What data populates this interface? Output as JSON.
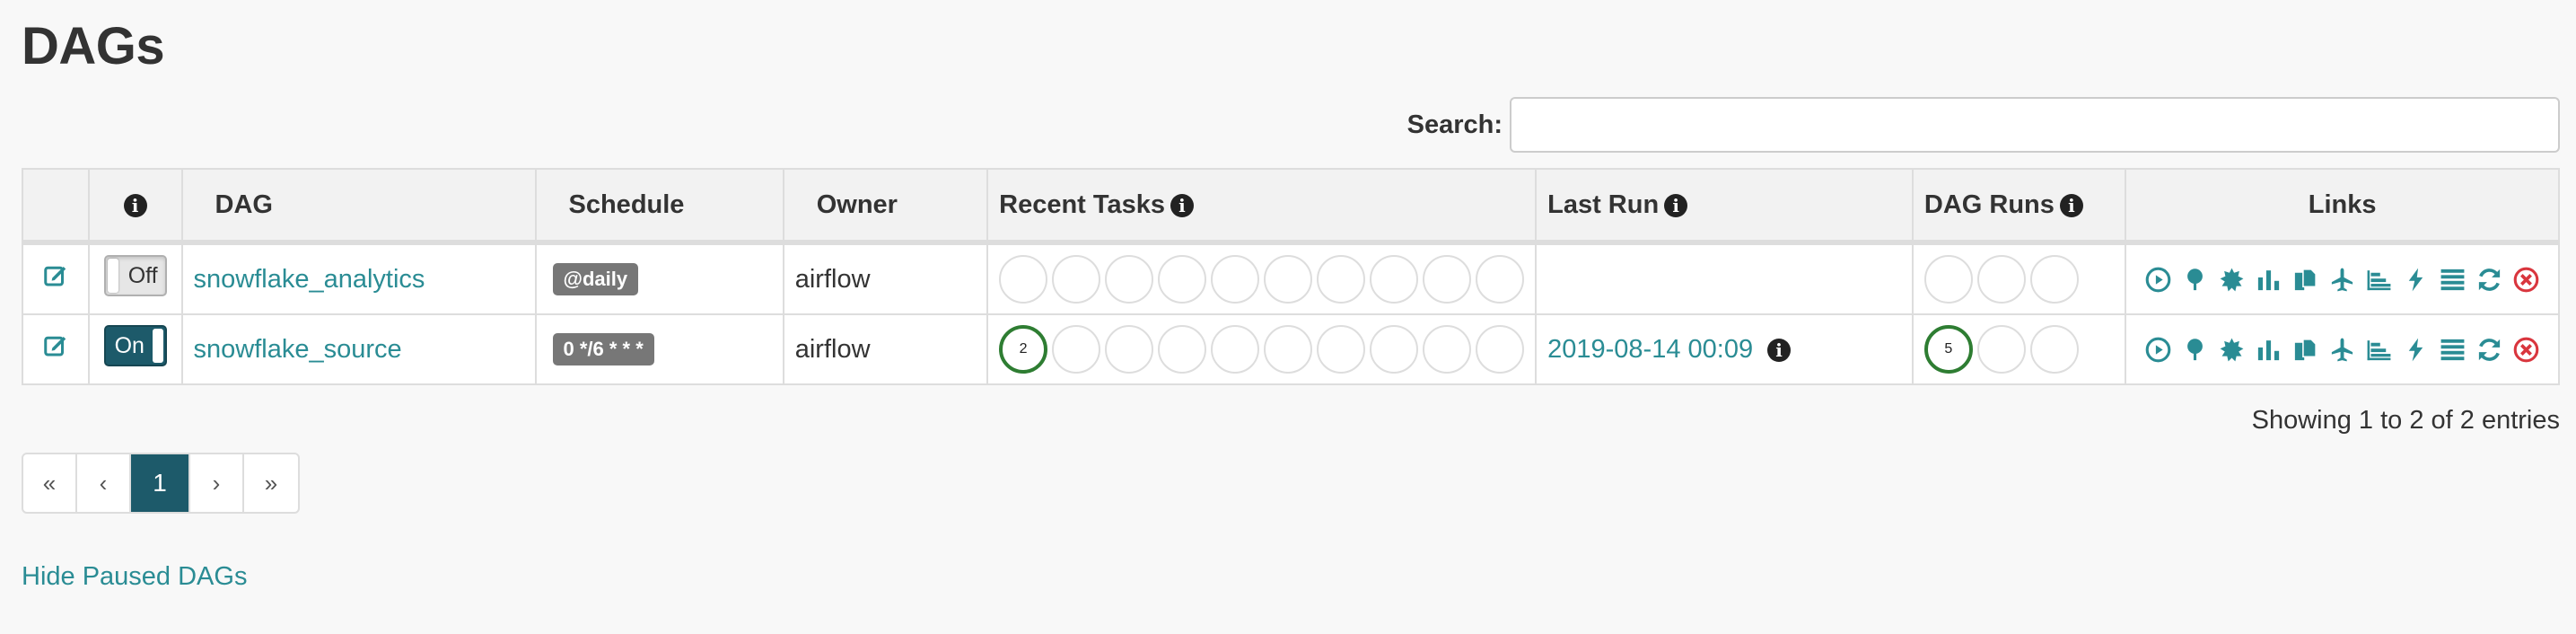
{
  "page": {
    "title": "DAGs"
  },
  "search": {
    "label": "Search:",
    "value": ""
  },
  "table": {
    "headers": {
      "dag": "DAG",
      "schedule": "Schedule",
      "owner": "Owner",
      "recent_tasks": "Recent Tasks",
      "last_run": "Last Run",
      "dag_runs": "DAG Runs",
      "links": "Links"
    },
    "rows": [
      {
        "toggle": "Off",
        "dag_id": "snowflake_analytics",
        "schedule": "@daily",
        "owner": "airflow",
        "recent_tasks": [
          "",
          "",
          "",
          "",
          "",
          "",
          "",
          "",
          "",
          ""
        ],
        "last_run": "",
        "dag_runs": [
          "",
          "",
          ""
        ]
      },
      {
        "toggle": "On",
        "dag_id": "snowflake_source",
        "schedule": "0 */6 * * *",
        "owner": "airflow",
        "recent_tasks": [
          "2",
          "",
          "",
          "",
          "",
          "",
          "",
          "",
          "",
          ""
        ],
        "last_run": "2019-08-14 00:09",
        "dag_runs": [
          "5",
          "",
          ""
        ]
      }
    ],
    "link_icons": [
      "trigger-dag-icon",
      "tree-view-icon",
      "graph-view-icon",
      "task-duration-icon",
      "task-tries-icon",
      "landing-times-icon",
      "gantt-icon",
      "code-view-icon",
      "logs-icon",
      "refresh-icon",
      "delete-icon"
    ]
  },
  "footer": {
    "entries_info": "Showing 1 to 2 of 2 entries",
    "pager": {
      "first": "«",
      "prev": "‹",
      "current": "1",
      "next": "›",
      "last": "»"
    },
    "hide_paused": "Hide Paused DAGs"
  },
  "colors": {
    "accent": "#2a8c94",
    "toggle_on": "#1d5a6a",
    "success": "#2e7d32",
    "badge": "#777777",
    "delete": "#d9363e"
  }
}
